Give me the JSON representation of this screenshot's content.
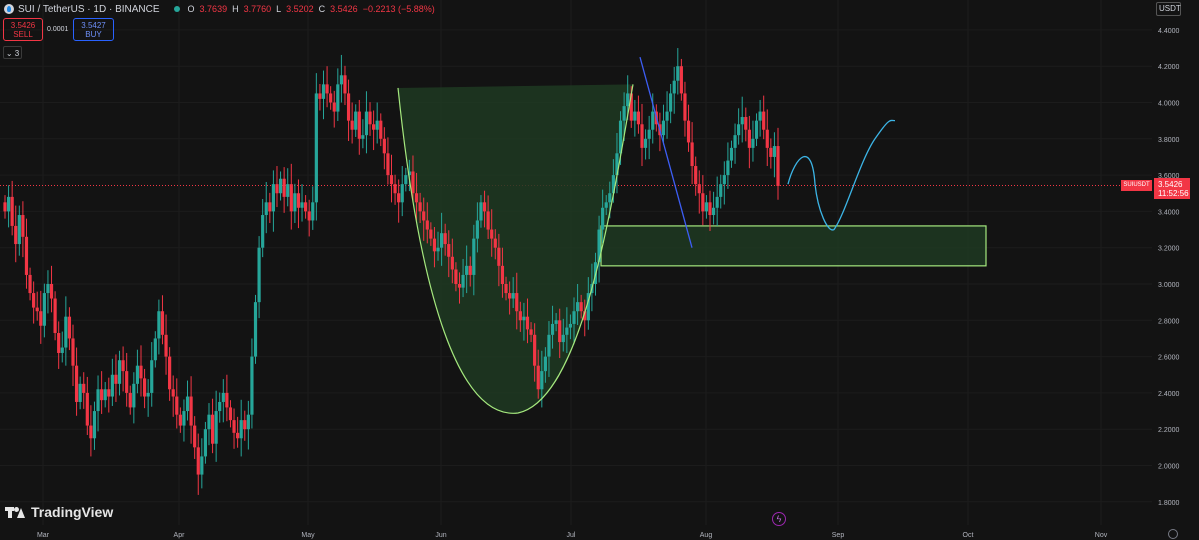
{
  "header": {
    "title": "SUI / TetherUS · 1D · BINANCE",
    "ohlc": [
      {
        "label": "O",
        "value": "3.7639"
      },
      {
        "label": "H",
        "value": "3.7760"
      },
      {
        "label": "L",
        "value": "3.5202"
      },
      {
        "label": "C",
        "value": "3.5426"
      },
      {
        "label": "",
        "value": "−0.2213 (−5.88%)"
      }
    ]
  },
  "trade": {
    "sell_price": "3.5426",
    "sell_label": "SELL",
    "spread": "0.0001",
    "buy_price": "3.5427",
    "buy_label": "BUY"
  },
  "indicator_toggle": "⌄ 3",
  "currency": "USDT",
  "logo_text": "TradingView",
  "price_tag": {
    "symbol": "SUIUSDT",
    "price": "3.5426",
    "countdown": "11:52:56"
  },
  "colors": {
    "background": "#131313",
    "up": "#26a69a",
    "down": "#f23645",
    "zone_fill": "#1e3a22",
    "zone_border": "#a5e87e",
    "trendline": "#3d5ef5",
    "projection": "#3cb4e5"
  },
  "chart_data": {
    "type": "candlestick",
    "symbol": "SUIUSDT",
    "interval": "1D",
    "ylim": [
      1.7,
      4.5
    ],
    "y_ticks": [
      "4.4000",
      "4.2000",
      "4.0000",
      "3.8000",
      "3.6000",
      "3.4000",
      "3.2000",
      "3.0000",
      "2.8000",
      "2.6000",
      "2.4000",
      "2.2000",
      "2.0000",
      "1.8000"
    ],
    "x_ticks": [
      "Mar",
      "Apr",
      "May",
      "Jun",
      "Jul",
      "Aug",
      "Sep",
      "Oct",
      "Nov"
    ],
    "last_price": 3.5426,
    "close_series": [
      3.4,
      3.48,
      3.32,
      3.22,
      3.38,
      3.26,
      3.05,
      2.95,
      2.87,
      2.85,
      2.77,
      2.95,
      3.0,
      2.92,
      2.73,
      2.62,
      2.65,
      2.82,
      2.7,
      2.55,
      2.35,
      2.45,
      2.4,
      2.22,
      2.15,
      2.3,
      2.42,
      2.36,
      2.42,
      2.38,
      2.5,
      2.45,
      2.58,
      2.52,
      2.4,
      2.32,
      2.45,
      2.55,
      2.48,
      2.38,
      2.4,
      2.58,
      2.7,
      2.85,
      2.72,
      2.6,
      2.42,
      2.38,
      2.28,
      2.22,
      2.3,
      2.38,
      2.22,
      2.1,
      1.95,
      2.05,
      2.2,
      2.28,
      2.12,
      2.3,
      2.35,
      2.4,
      2.32,
      2.25,
      2.18,
      2.15,
      2.25,
      2.2,
      2.28,
      2.6,
      2.9,
      3.2,
      3.38,
      3.45,
      3.4,
      3.55,
      3.5,
      3.58,
      3.48,
      3.55,
      3.4,
      3.5,
      3.42,
      3.45,
      3.4,
      3.35,
      3.45,
      4.05,
      4.02,
      4.1,
      4.05,
      4.0,
      3.95,
      4.1,
      4.15,
      4.05,
      3.9,
      3.85,
      3.95,
      3.8,
      3.82,
      3.95,
      3.88,
      3.85,
      3.9,
      3.8,
      3.72,
      3.6,
      3.55,
      3.5,
      3.45,
      3.55,
      3.6,
      3.62,
      3.5,
      3.45,
      3.4,
      3.35,
      3.3,
      3.25,
      3.18,
      3.2,
      3.28,
      3.22,
      3.15,
      3.08,
      3.0,
      2.98,
      3.05,
      3.1,
      3.05,
      3.25,
      3.35,
      3.45,
      3.4,
      3.3,
      3.25,
      3.2,
      3.1,
      3.0,
      2.95,
      2.92,
      2.95,
      2.85,
      2.8,
      2.82,
      2.75,
      2.72,
      2.55,
      2.42,
      2.52,
      2.6,
      2.72,
      2.78,
      2.8,
      2.68,
      2.72,
      2.76,
      2.78,
      2.85,
      2.9,
      2.85,
      2.8,
      2.95,
      3.0,
      3.12,
      3.3,
      3.42,
      3.45,
      3.5,
      3.6,
      3.72,
      3.9,
      3.98,
      4.05,
      3.9,
      3.95,
      3.88,
      3.75,
      3.8,
      3.85,
      3.95,
      3.88,
      3.82,
      3.9,
      3.95,
      4.05,
      4.12,
      4.2,
      4.05,
      3.9,
      3.78,
      3.65,
      3.55,
      3.5,
      3.4,
      3.45,
      3.38,
      3.42,
      3.48,
      3.55,
      3.6,
      3.68,
      3.75,
      3.82,
      3.88,
      3.92,
      3.85,
      3.75,
      3.8,
      3.9,
      3.95,
      3.85,
      3.75,
      3.7,
      3.76,
      3.54
    ],
    "annotations": [
      {
        "type": "cup_pattern",
        "label": ""
      },
      {
        "type": "demand_zone",
        "from": 3.1,
        "to": 3.32
      },
      {
        "type": "descending_trendline",
        "start": 4.25,
        "end": 3.2
      },
      {
        "type": "projected_path",
        "points": [
          3.55,
          3.75,
          3.55,
          3.3,
          3.45,
          3.72,
          3.9
        ]
      }
    ]
  }
}
